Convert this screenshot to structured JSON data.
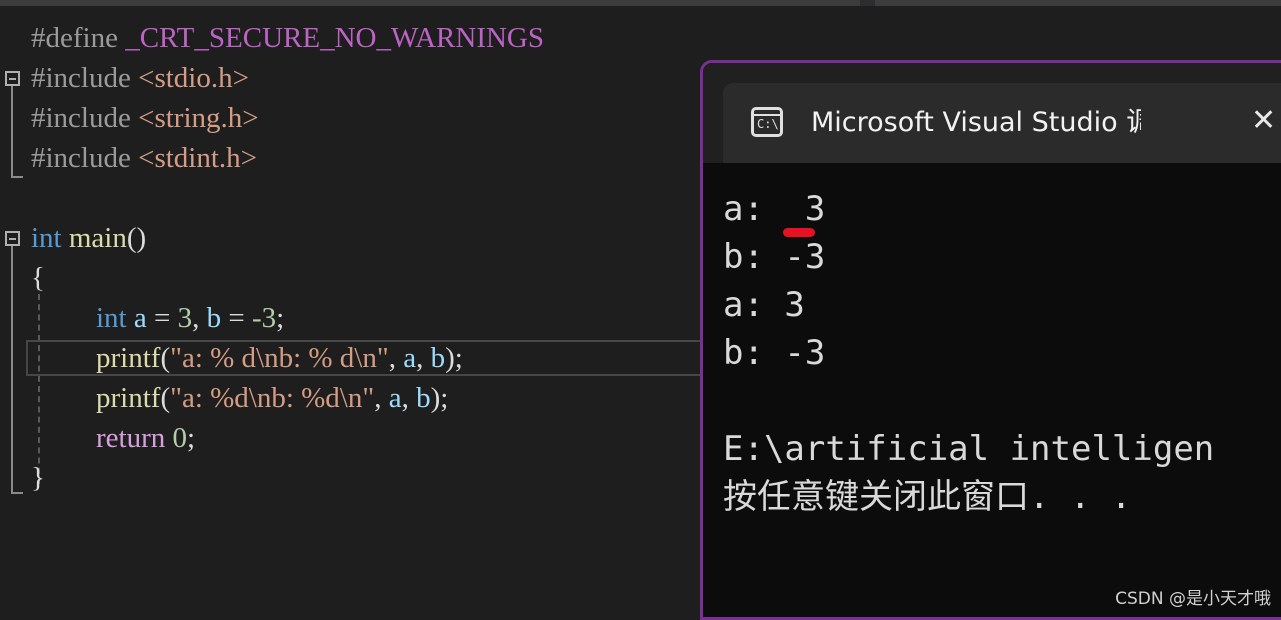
{
  "editor": {
    "lines": {
      "l1_define": "#define",
      "l1_macro": "_CRT_SECURE_NO_WARNINGS",
      "l2_include": "#include",
      "l2_header": "<stdio.h>",
      "l3_include": "#include",
      "l3_header": "<string.h>",
      "l4_include": "#include",
      "l4_header": "<stdint.h>",
      "l6_type": "int",
      "l6_func": "main",
      "l6_paren": "()",
      "l7_brace": "{",
      "l8_type": "int",
      "l8_a": "a",
      "l8_eq1": " = ",
      "l8_3": "3",
      "l8_comma": ", ",
      "l8_b": "b",
      "l8_eq2": " = ",
      "l8_neg3": "-3",
      "l8_semi": ";",
      "l9_fn": "printf",
      "l9_open": "(",
      "l9_str": "\"a: % d\\nb: % d\\n\"",
      "l9_c1": ", ",
      "l9_a": "a",
      "l9_c2": ", ",
      "l9_b": "b",
      "l9_close": ");",
      "l10_fn": "printf",
      "l10_open": "(",
      "l10_str": "\"a: %d\\nb: %d\\n\"",
      "l10_c1": ", ",
      "l10_a": "a",
      "l10_c2": ", ",
      "l10_b": "b",
      "l10_close": ");",
      "l11_ret": "return",
      "l11_val": " 0",
      "l11_semi": ";",
      "l12_brace": "}"
    }
  },
  "console": {
    "title": "Microsoft Visual Studio 调试控制台",
    "icon_label": "C:\\",
    "close_glyph": "✕",
    "output": [
      "a:  3",
      "b: -3",
      "a: 3",
      "b: -3",
      "",
      "E:\\artificial intelligen",
      "按任意键关闭此窗口. . ."
    ]
  },
  "watermark": "CSDN @是小天才哦",
  "colors": {
    "keyword": "#569cd6",
    "string": "#d69d85",
    "window_border": "#7a2f96",
    "marker_red": "#e81123"
  }
}
